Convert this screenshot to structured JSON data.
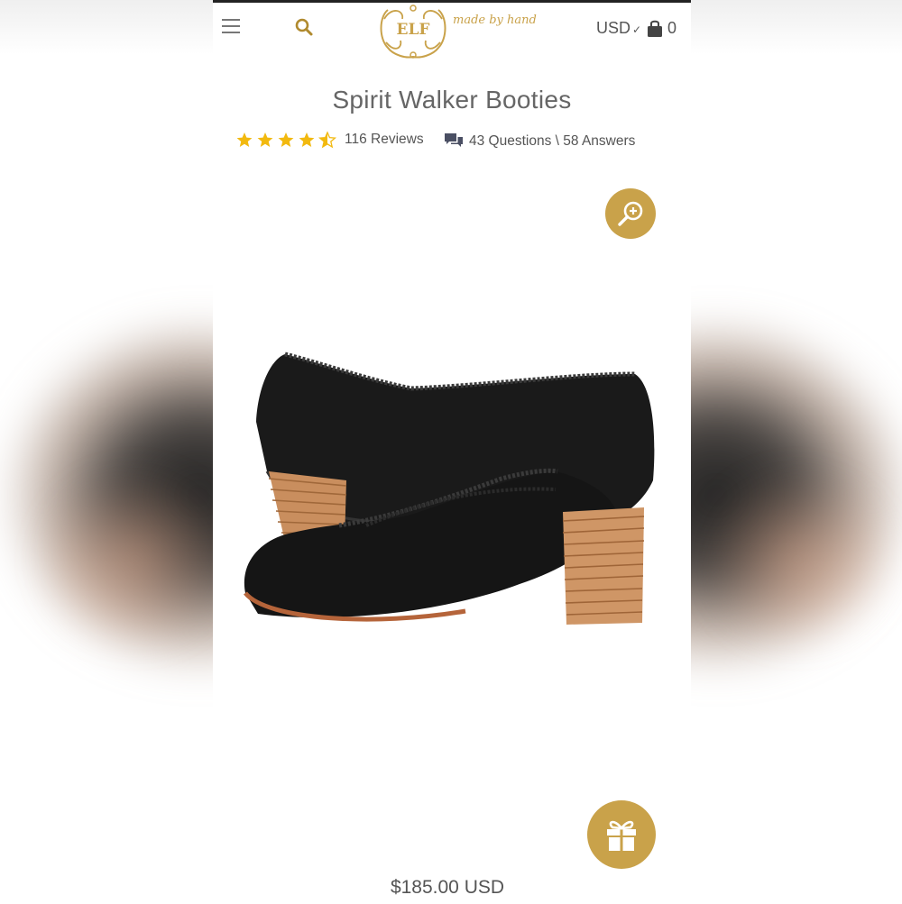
{
  "header": {
    "logo_text": "ELF",
    "logo_tagline": "made by hand",
    "currency": "USD",
    "cart_count": "0"
  },
  "product": {
    "title": "Spirit Walker Booties",
    "rating_stars": 4.5,
    "reviews_label": "116 Reviews",
    "qa_label": "43 Questions \\ 58 Answers",
    "price": "$185.00 USD"
  },
  "icons": {
    "menu": "hamburger-icon",
    "search": "search-icon",
    "cart": "shopping-bag-icon",
    "reviews": "star-icon",
    "qa": "chat-bubbles-icon",
    "zoom": "zoom-in-icon",
    "gift": "gift-icon"
  },
  "colors": {
    "accent_gold": "#c9a24a",
    "star_gold": "#f2b90f",
    "text_gray": "#555555"
  }
}
